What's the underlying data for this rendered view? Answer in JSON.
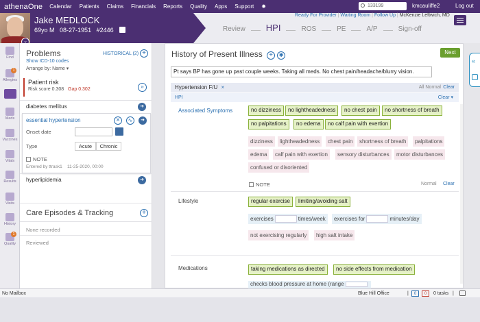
{
  "topbar": {
    "brand": "athenaOne",
    "nav": [
      "Calendar",
      "Patients",
      "Claims",
      "Financials",
      "Reports",
      "Quality",
      "Apps",
      "Support"
    ],
    "search_value": "133199",
    "user": "kmcauliffe2",
    "logout": "Log out"
  },
  "patient": {
    "name": "Jake MEDLOCK",
    "age_sex": "69yo M",
    "dob": "08-27-1951",
    "id": "#2446"
  },
  "workflow": {
    "steps": [
      "Review",
      "HPI",
      "ROS",
      "PE",
      "A/P",
      "Sign-off"
    ],
    "active": "HPI"
  },
  "provider_links": {
    "ready": "Ready For Provider",
    "waiting": "Waiting Room",
    "follow": "Follow Up",
    "provider": "McKenzie Leftwich, MD"
  },
  "leftnav": [
    {
      "label": "Find"
    },
    {
      "label": "Allergies",
      "badge": "1"
    },
    {
      "label": ""
    },
    {
      "label": "Meds"
    },
    {
      "label": "Vaccines"
    },
    {
      "label": "Vitals"
    },
    {
      "label": "Results"
    },
    {
      "label": "Visits"
    },
    {
      "label": "History"
    },
    {
      "label": "Quality",
      "badge": "1"
    }
  ],
  "problems": {
    "title": "Problems",
    "historical": "HISTORICAL (2)",
    "show_icd": "Show ICD-10 codes",
    "arrange": "Arrange by: Name",
    "risk_title": "Patient risk",
    "risk_score_label": "Risk score",
    "risk_score": "0.308",
    "gap_label": "Gap",
    "gap": "0.302",
    "diabetes": "diabetes mellitus",
    "hypertension": "essential hypertension",
    "onset_label": "Onset date",
    "type_label": "Type",
    "acute": "Acute",
    "chronic": "Chronic",
    "note": "NOTE",
    "entered_by": "Entered by ttrask1",
    "entered_date": "11-25-2020, 00:00",
    "hyperlipidemia": "hyperlipidemia",
    "care_title": "Care Episodes & Tracking",
    "none_recorded": "None recorded",
    "reviewed": "Reviewed"
  },
  "hpi": {
    "title": "History of Present Illness",
    "next": "Next",
    "freetext": "Pt says BP has gone up past couple weeks. Taking all meds. No chest pain/headache/blurry vision.",
    "template": "Hypertension F/U",
    "all_normal": "All Normal",
    "clear": "Clear",
    "hpi_label": "HPI",
    "assoc_label": "Associated Symptoms",
    "assoc_pos_row1": [
      "no dizziness",
      "no lightheadedness",
      "no chest pain",
      "no shortness of breath"
    ],
    "assoc_pos_row2": [
      "no palpitations",
      "no edema",
      "no calf pain with exertion"
    ],
    "assoc_neg_row1": [
      "dizziness",
      "lightheadedness",
      "chest pain",
      "shortness of breath",
      "palpitations"
    ],
    "assoc_neg_row2": [
      "edema",
      "calf pain with exertion",
      "sensory disturbances",
      "motor disturbances"
    ],
    "assoc_neg_row3": [
      "confused or disoriented"
    ],
    "note": "NOTE",
    "normal": "Normal",
    "lifestyle_label": "Lifestyle",
    "lifestyle_pos": [
      "regular exercise",
      "limiting/avoiding salt"
    ],
    "exercises": "exercises",
    "times_week": "times/week",
    "exercises_for": "exercises for",
    "minutes_day": "minutes/day",
    "lifestyle_neg": [
      "not exercising regularly",
      "high salt intake"
    ],
    "meds_label": "Medications",
    "meds_pos": [
      "taking medications as directed",
      "no side effects from medication"
    ],
    "meds_partial": "checks blood pressure at home (range"
  },
  "status": {
    "mailbox": "No Mailbox",
    "office": "Blue Hill Office",
    "count1": "0",
    "count2": "0",
    "tasks": "0 tasks"
  },
  "colors": {
    "brand_purple": "#4b2f72",
    "link_blue": "#2a6fb0",
    "positive_green": "#8ab13b",
    "next_green": "#6a9f2e",
    "risk_red": "#c0392b"
  }
}
